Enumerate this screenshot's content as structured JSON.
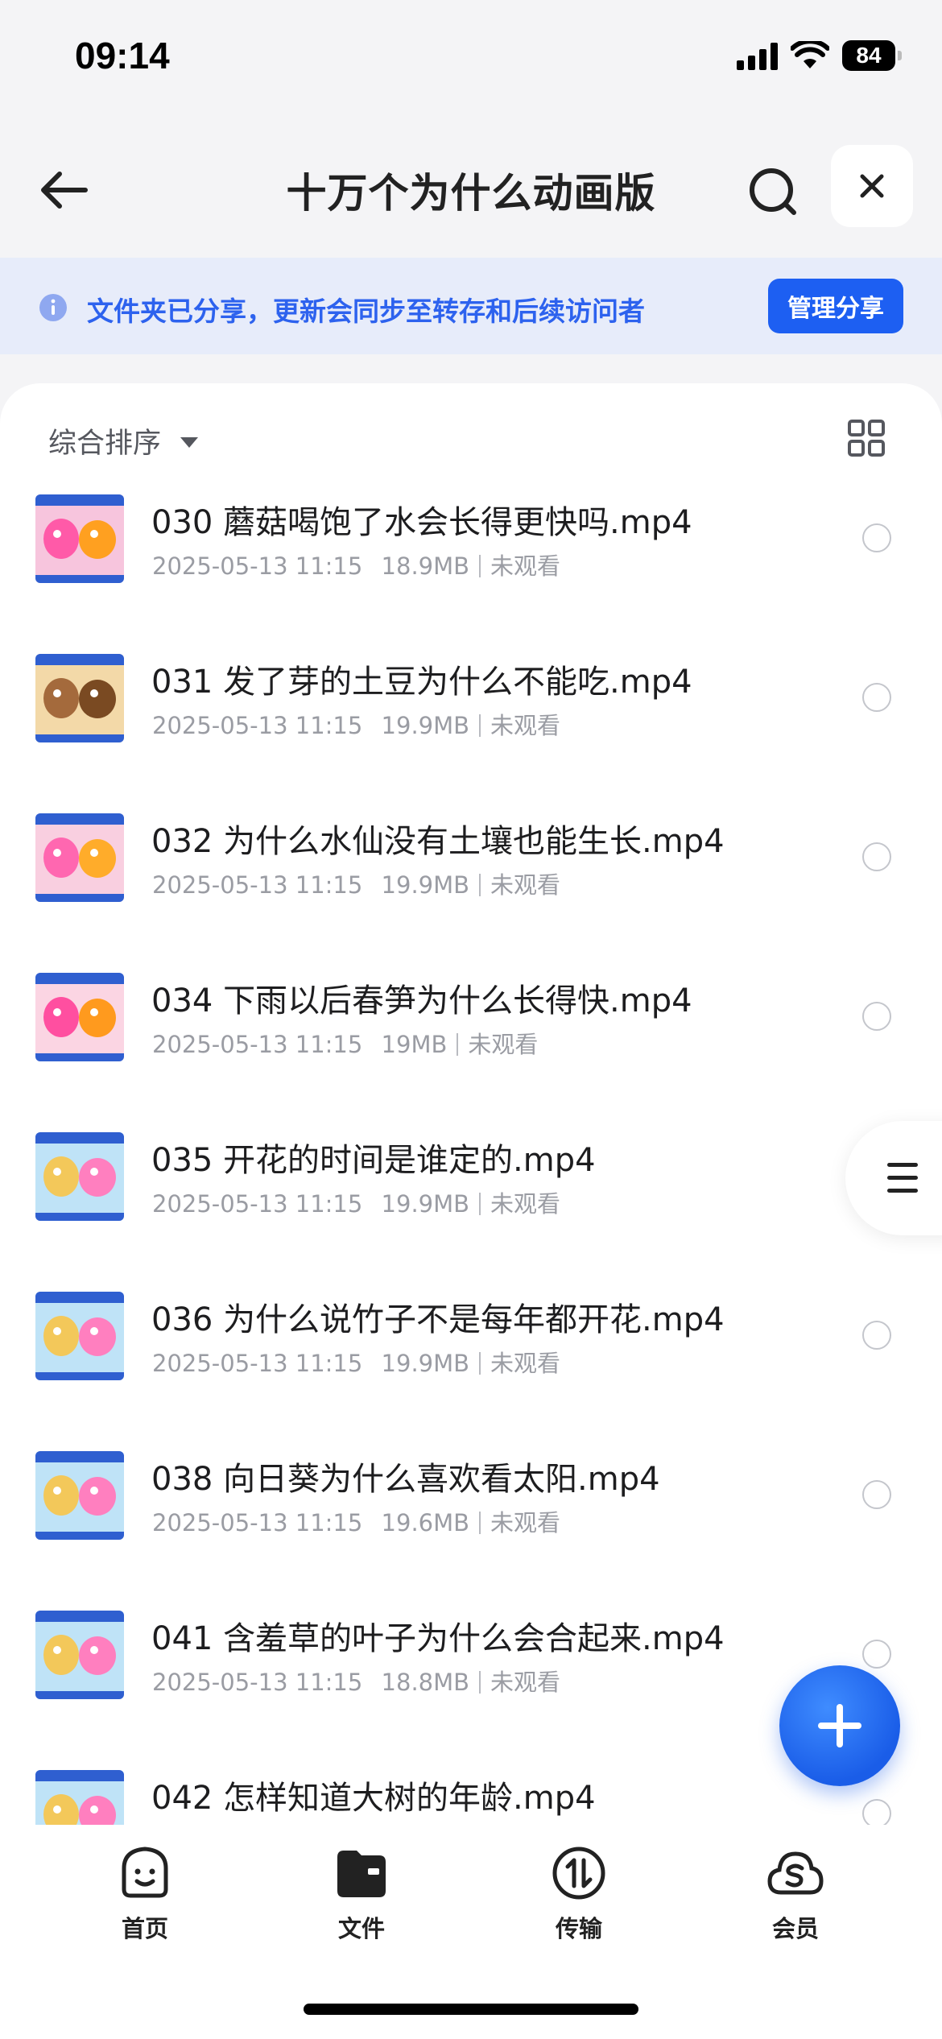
{
  "status_bar": {
    "time": "09:14",
    "battery": "84"
  },
  "nav": {
    "title": "十万个为什么动画版",
    "back_icon": "arrow-left-icon",
    "search_icon": "search-icon",
    "close_icon": "close-icon"
  },
  "share_banner": {
    "text": "文件夹已分享，更新会同步至转存和后续访问者",
    "button": "管理分享",
    "icon": "info-icon",
    "accent": "#1d5ff2"
  },
  "sort": {
    "label": "综合排序"
  },
  "files": [
    {
      "name": "030 蘑菇喝饱了水会长得更快吗.mp4",
      "date": "2025-05-13 11:15",
      "size": "18.9MB",
      "status": "未观看"
    },
    {
      "name": "031 发了芽的土豆为什么不能吃.mp4",
      "date": "2025-05-13 11:15",
      "size": "19.9MB",
      "status": "未观看"
    },
    {
      "name": "032 为什么水仙没有土壤也能生长.mp4",
      "date": "2025-05-13 11:15",
      "size": "19.9MB",
      "status": "未观看"
    },
    {
      "name": "034 下雨以后春笋为什么长得快.mp4",
      "date": "2025-05-13 11:15",
      "size": "19MB",
      "status": "未观看"
    },
    {
      "name": "035 开花的时间是谁定的.mp4",
      "date": "2025-05-13 11:15",
      "size": "19.9MB",
      "status": "未观看"
    },
    {
      "name": "036 为什么说竹子不是每年都开花.mp4",
      "date": "2025-05-13 11:15",
      "size": "19.9MB",
      "status": "未观看"
    },
    {
      "name": "038 向日葵为什么喜欢看太阳.mp4",
      "date": "2025-05-13 11:15",
      "size": "19.6MB",
      "status": "未观看"
    },
    {
      "name": "041 含羞草的叶子为什么会合起来.mp4",
      "date": "2025-05-13 11:15",
      "size": "18.8MB",
      "status": "未观看"
    },
    {
      "name": "042 怎样知道大树的年龄.mp4",
      "date": "",
      "size": "",
      "status": ""
    }
  ],
  "tabs": [
    {
      "label": "首页",
      "icon": "home-face-icon"
    },
    {
      "label": "文件",
      "icon": "folder-icon"
    },
    {
      "label": "传输",
      "icon": "transfer-icon"
    },
    {
      "label": "会员",
      "icon": "member-cloud-icon"
    }
  ]
}
